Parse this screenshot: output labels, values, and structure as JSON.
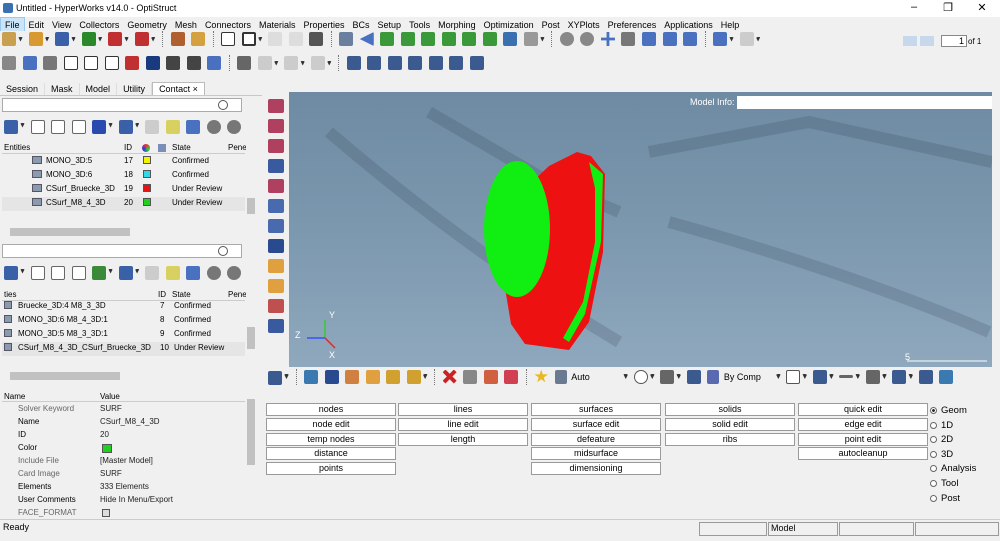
{
  "window": {
    "title": "Untitled - HyperWorks v14.0 - OptiStruct",
    "minimize": "–",
    "restore": "❐",
    "close": "✕"
  },
  "menu": [
    "File",
    "Edit",
    "View",
    "Collectors",
    "Geometry",
    "Mesh",
    "Connectors",
    "Materials",
    "Properties",
    "BCs",
    "Setup",
    "Tools",
    "Morphing",
    "Optimization",
    "Post",
    "XYPlots",
    "Preferences",
    "Applications",
    "Help"
  ],
  "toolbar": {
    "page_value": "1",
    "page_of": "of 1"
  },
  "browser_tabs": [
    "Session",
    "Mask",
    "Model",
    "Utility",
    "Contact ×"
  ],
  "entities_table": {
    "headers": {
      "name": "Entities",
      "id": "ID",
      "state": "State",
      "pen": "Pene"
    },
    "rows": [
      {
        "name": "MONO_3D:5",
        "id": "17",
        "color": "#f3f300",
        "state": "Confirmed"
      },
      {
        "name": "MONO_3D:6",
        "id": "18",
        "color": "#30d8e8",
        "state": "Confirmed"
      },
      {
        "name": "CSurf_Bruecke_3D",
        "id": "19",
        "color": "#e81414",
        "state": "Under Review"
      },
      {
        "name": "CSurf_M8_4_3D",
        "id": "20",
        "color": "#20d020",
        "state": "Under Review"
      }
    ]
  },
  "ties_table": {
    "headers": {
      "name": "ties",
      "id": "ID",
      "state": "State",
      "pen": "Pene"
    },
    "rows": [
      {
        "name": "Bruecke_3D:4 M8_3_3D",
        "id": "7",
        "state": "Confirmed"
      },
      {
        "name": "MONO_3D:6 M8_4_3D:1",
        "id": "8",
        "state": "Confirmed"
      },
      {
        "name": "MONO_3D:5 M8_3_3D:1",
        "id": "9",
        "state": "Confirmed"
      },
      {
        "name": "CSurf_M8_4_3D_CSurf_Bruecke_3D",
        "id": "10",
        "state": "Under Review"
      }
    ]
  },
  "properties": {
    "headers": {
      "name": "Name",
      "value": "Value"
    },
    "rows": [
      {
        "name": "Solver Keyword",
        "value": "SURF"
      },
      {
        "name": "Name",
        "value": "CSurf_M8_4_3D"
      },
      {
        "name": "ID",
        "value": "20"
      },
      {
        "name": "Color",
        "value": ""
      },
      {
        "name": "Include File",
        "value": "[Master Model]"
      },
      {
        "name": "Card Image",
        "value": "SURF"
      },
      {
        "name": "Elements",
        "value": "333 Elements"
      },
      {
        "name": "User Comments",
        "value": "Hide In Menu/Export"
      },
      {
        "name": "FACE_FORMAT",
        "value": ""
      }
    ],
    "color_swatch": "#20d020"
  },
  "viewport": {
    "model_info_label": "Model Info:",
    "triad": {
      "y": "Y",
      "z": "Z",
      "x": "X"
    },
    "scale_label": "5"
  },
  "view_toolbar": {
    "auto": "Auto",
    "bycomp": "By Comp"
  },
  "panel_buttons": [
    [
      "nodes",
      "lines",
      "surfaces",
      "solids",
      "quick edit"
    ],
    [
      "node edit",
      "line edit",
      "surface edit",
      "solid edit",
      "edge edit"
    ],
    [
      "temp nodes",
      "length",
      "defeature",
      "ribs",
      "point edit"
    ],
    [
      "distance",
      "",
      "midsurface",
      "",
      "autocleanup"
    ],
    [
      "points",
      "",
      "dimensioning",
      "",
      ""
    ]
  ],
  "panel_radios": [
    {
      "label": "Geom",
      "on": true
    },
    {
      "label": "1D"
    },
    {
      "label": "2D"
    },
    {
      "label": "3D"
    },
    {
      "label": "Analysis"
    },
    {
      "label": "Tool"
    },
    {
      "label": "Post"
    }
  ],
  "status": {
    "left": "Ready",
    "model": "Model"
  }
}
